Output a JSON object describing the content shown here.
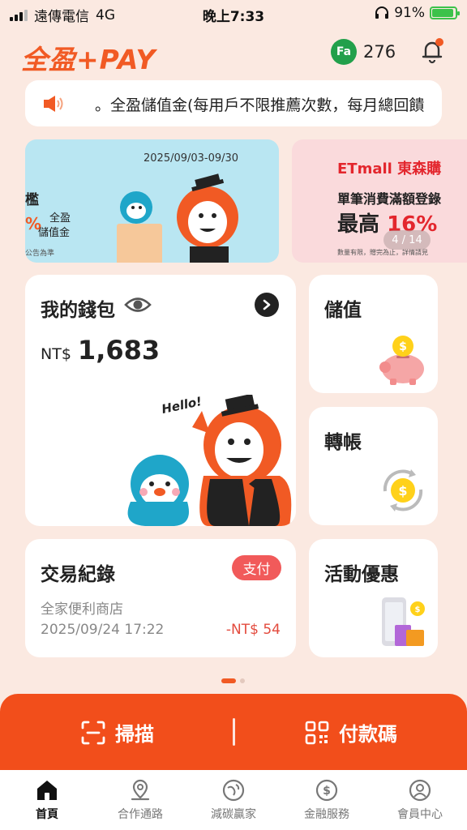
{
  "status_bar": {
    "carrier": "遠傳電信",
    "network": "4G",
    "time": "晚上7:33",
    "battery": "91%"
  },
  "header": {
    "logo": "全盈+PAY",
    "points_icon": "Fa",
    "points": "276",
    "notification_icon": "bell-icon"
  },
  "marquee": {
    "icon": "speaker-icon",
    "text": "。全盈儲值金(每用戶不限推薦次數，每月總回饋"
  },
  "banners": [
    {
      "date": "2025/09/03-09/30",
      "text_a": "檻",
      "text_b": "全盈",
      "text_c": "儲值金",
      "text_pct": "%",
      "footnote": "公告為準"
    },
    {
      "brand": "ETmall 東森購",
      "line1": "單筆消費滿額登錄",
      "line2_prefix": "最高",
      "line2_pct": "16%",
      "footnote": "數量有限，贈完為止，詳情請見",
      "pager": "4 / 14"
    }
  ],
  "wallet": {
    "title": "我的錢包",
    "currency": "NT$",
    "balance": "1,683",
    "hello": "Hello!"
  },
  "topup": {
    "title": "儲值"
  },
  "transfer": {
    "title": "轉帳"
  },
  "transactions": {
    "title": "交易紀錄",
    "badge": "支付",
    "store": "全家便利商店",
    "datetime": "2025/09/24 17:22",
    "amount": "-NT$ 54"
  },
  "promotions": {
    "title": "活動優惠"
  },
  "actions": {
    "scan": "掃描",
    "pay_code": "付款碼"
  },
  "tabs": [
    {
      "label": "首頁"
    },
    {
      "label": "合作通路"
    },
    {
      "label": "減碳贏家"
    },
    {
      "label": "金融服務"
    },
    {
      "label": "會員中心"
    }
  ],
  "colors": {
    "brand": "#F15A24",
    "action_bar": "#F24E1B",
    "background": "#FBE9E1",
    "badge": "#F15A5A"
  }
}
